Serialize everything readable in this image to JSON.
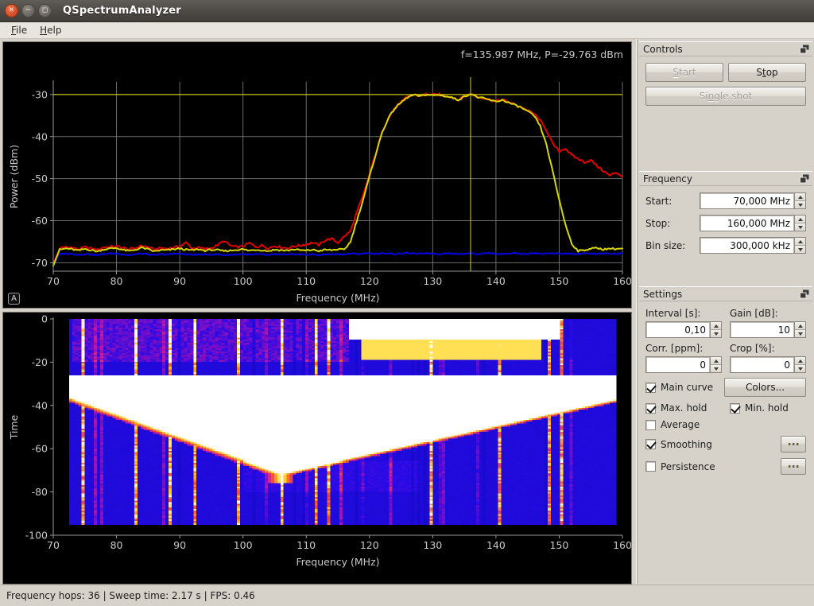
{
  "window": {
    "title": "QSpectrumAnalyzer",
    "close_icon": "close-icon",
    "minimize_icon": "minimize-icon",
    "maximize_icon": "maximize-icon"
  },
  "menubar": {
    "items": [
      {
        "label": "File",
        "mnemonic": "F"
      },
      {
        "label": "Help",
        "mnemonic": "H"
      }
    ]
  },
  "spectrum": {
    "cursor_readout": "f=135.987 MHz, P=-29.763 dBm",
    "autoscale_badge": "A",
    "xlabel": "Frequency (MHz)",
    "ylabel": "Power (dBm)"
  },
  "waterfall": {
    "xlabel": "Frequency (MHz)",
    "ylabel": "Time"
  },
  "controls": {
    "title": "Controls",
    "float_icon": "undock-icon",
    "start_label": "Start",
    "start_mnemonic": "S",
    "start_enabled": false,
    "stop_label": "Stop",
    "stop_mnemonic": "t",
    "stop_enabled": true,
    "single_shot_label": "Single shot",
    "single_shot_mnemonic": "n",
    "single_shot_enabled": false
  },
  "frequency": {
    "title": "Frequency",
    "float_icon": "undock-icon",
    "start_label": "Start:",
    "start_value": "70,000 MHz",
    "stop_label": "Stop:",
    "stop_value": "160,000 MHz",
    "bin_label": "Bin size:",
    "bin_value": "300,000 kHz"
  },
  "settings": {
    "title": "Settings",
    "float_icon": "undock-icon",
    "interval_label": "Interval [s]:",
    "interval_value": "0,10",
    "gain_label": "Gain [dB]:",
    "gain_value": "10",
    "corr_label": "Corr. [ppm]:",
    "corr_value": "0",
    "crop_label": "Crop [%]:",
    "crop_value": "0",
    "main_curve_label": "Main curve",
    "main_curve_checked": true,
    "colors_label": "Colors...",
    "max_hold_label": "Max. hold",
    "max_hold_checked": true,
    "min_hold_label": "Min. hold",
    "min_hold_checked": true,
    "average_label": "Average",
    "average_checked": false,
    "smoothing_label": "Smoothing",
    "smoothing_checked": true,
    "persistence_label": "Persistence",
    "persistence_checked": false,
    "smoothing_more_label": "...",
    "persistence_more_label": "..."
  },
  "statusbar": {
    "text": "Frequency hops: 36 | Sweep time: 2.17 s | FPS: 0.46"
  },
  "colors": {
    "main_curve": "#d8d800",
    "max_hold": "#e00000",
    "min_hold": "#0000e8",
    "cursor": "#d8d400",
    "grid": "#808080",
    "plot_bg": "#000000",
    "axis_text": "#c8c8c8",
    "accent": "#d4482a"
  },
  "chart_data": [
    {
      "type": "line",
      "id": "spectrum",
      "title": "",
      "xlabel": "Frequency (MHz)",
      "ylabel": "Power (dBm)",
      "xlim": [
        70,
        160
      ],
      "ylim": [
        -72,
        -27
      ],
      "xticks": [
        70,
        80,
        90,
        100,
        110,
        120,
        130,
        140,
        150,
        160
      ],
      "yticks": [
        -30,
        -40,
        -50,
        -60,
        -70
      ],
      "grid": true,
      "legend": "none",
      "annotations": [
        "f=135.987 MHz, P=-29.763 dBm"
      ],
      "cursor": {
        "x": 135.987,
        "y": -29.763
      },
      "x": [
        70,
        71,
        72,
        73,
        74,
        75,
        76,
        77,
        78,
        79,
        80,
        81,
        82,
        83,
        84,
        85,
        86,
        87,
        88,
        89,
        90,
        91,
        92,
        93,
        94,
        95,
        96,
        97,
        98,
        99,
        100,
        101,
        102,
        103,
        104,
        105,
        106,
        107,
        108,
        109,
        110,
        111,
        112,
        113,
        114,
        115,
        116,
        117,
        118,
        119,
        120,
        121,
        122,
        123,
        124,
        125,
        126,
        127,
        128,
        129,
        130,
        131,
        132,
        133,
        134,
        135,
        136,
        137,
        138,
        139,
        140,
        141,
        142,
        143,
        144,
        145,
        146,
        147,
        148,
        149,
        150,
        151,
        152,
        153,
        154,
        155,
        156,
        157,
        158,
        159,
        160
      ],
      "series": [
        {
          "name": "Max. hold",
          "color": "#e00000",
          "values": [
            -70.5,
            -66.6,
            -66.2,
            -66.4,
            -66.8,
            -66.3,
            -66.6,
            -66.9,
            -66.3,
            -66.2,
            -66.1,
            -66.4,
            -66.8,
            -66.5,
            -65.9,
            -66.3,
            -66.9,
            -66.5,
            -66.6,
            -66.4,
            -66.1,
            -65.2,
            -66.6,
            -66.4,
            -66.7,
            -66.5,
            -65.8,
            -64.8,
            -65.9,
            -66.3,
            -66.1,
            -65.3,
            -66.2,
            -65.9,
            -66.5,
            -66.0,
            -66.3,
            -66.5,
            -66.1,
            -65.9,
            -65.6,
            -65.2,
            -65.8,
            -64.6,
            -64.3,
            -65.2,
            -63.8,
            -62.5,
            -58.0,
            -54.0,
            -49.0,
            -44.0,
            -39.0,
            -35.5,
            -33.2,
            -31.8,
            -30.6,
            -30.0,
            -30.3,
            -29.9,
            -30.1,
            -30.0,
            -30.3,
            -30.6,
            -31.2,
            -30.4,
            -29.8,
            -30.5,
            -30.8,
            -31.2,
            -31.6,
            -31.2,
            -31.8,
            -32.4,
            -33.0,
            -33.8,
            -34.5,
            -36.2,
            -38.5,
            -41.8,
            -43.5,
            -42.8,
            -44.5,
            -45.3,
            -46.1,
            -45.6,
            -47.0,
            -48.2,
            -49.3,
            -48.5,
            -49.5
          ]
        },
        {
          "name": "Main curve",
          "color": "#d8d800",
          "values": [
            -70.5,
            -66.9,
            -66.6,
            -66.8,
            -67.1,
            -66.7,
            -67.0,
            -67.3,
            -66.8,
            -66.6,
            -66.5,
            -66.9,
            -67.2,
            -66.9,
            -66.4,
            -66.8,
            -67.3,
            -67.0,
            -67.0,
            -66.8,
            -66.6,
            -66.9,
            -67.0,
            -66.8,
            -67.1,
            -66.9,
            -67.0,
            -67.2,
            -67.1,
            -66.9,
            -66.8,
            -67.1,
            -66.9,
            -67.0,
            -67.2,
            -66.9,
            -67.0,
            -67.1,
            -66.8,
            -67.0,
            -67.1,
            -66.9,
            -67.2,
            -66.9,
            -67.0,
            -66.8,
            -66.9,
            -65.0,
            -60.0,
            -55.0,
            -49.5,
            -44.2,
            -39.0,
            -35.6,
            -33.3,
            -31.9,
            -30.7,
            -30.1,
            -30.4,
            -30.0,
            -30.2,
            -30.1,
            -30.4,
            -30.7,
            -31.3,
            -30.5,
            -29.8,
            -30.6,
            -30.9,
            -31.3,
            -31.7,
            -31.3,
            -31.9,
            -32.5,
            -33.1,
            -34.0,
            -35.0,
            -37.5,
            -42.0,
            -48.5,
            -55.0,
            -61.0,
            -65.5,
            -67.2,
            -67.0,
            -66.6,
            -66.5,
            -66.8,
            -66.6,
            -66.7,
            -66.6
          ]
        },
        {
          "name": "Min. hold",
          "color": "#0000e8",
          "values": [
            -70.5,
            -68.0,
            -67.8,
            -67.9,
            -68.1,
            -67.9,
            -68.0,
            -68.2,
            -67.9,
            -67.8,
            -67.8,
            -68.0,
            -68.2,
            -68.0,
            -67.8,
            -68.0,
            -68.2,
            -68.0,
            -68.0,
            -67.9,
            -67.8,
            -68.0,
            -68.1,
            -68.0,
            -68.1,
            -68.0,
            -68.0,
            -68.2,
            -68.1,
            -68.0,
            -67.9,
            -68.1,
            -68.0,
            -68.0,
            -68.2,
            -68.0,
            -68.0,
            -68.1,
            -67.9,
            -68.0,
            -68.1,
            -68.0,
            -68.2,
            -68.0,
            -68.0,
            -67.9,
            -68.0,
            -67.8,
            -67.9,
            -67.8,
            -67.7,
            -67.9,
            -67.8,
            -67.7,
            -67.9,
            -67.8,
            -67.7,
            -67.8,
            -67.9,
            -67.7,
            -67.8,
            -67.9,
            -67.7,
            -67.8,
            -67.9,
            -67.8,
            -67.7,
            -67.9,
            -67.8,
            -67.7,
            -67.8,
            -67.9,
            -67.8,
            -67.7,
            -67.9,
            -67.8,
            -67.7,
            -67.9,
            -67.8,
            -67.8,
            -67.9,
            -67.8,
            -67.8,
            -67.9,
            -67.8,
            -67.8,
            -67.9,
            -67.8,
            -67.8,
            -67.9,
            -67.8
          ]
        }
      ]
    },
    {
      "type": "heatmap",
      "id": "waterfall",
      "title": "",
      "xlabel": "Frequency (MHz)",
      "ylabel": "Time",
      "xlim": [
        70,
        160
      ],
      "ylim": [
        -100,
        0
      ],
      "xticks": [
        70,
        80,
        90,
        100,
        110,
        120,
        130,
        140,
        150,
        160
      ],
      "yticks": [
        0,
        -20,
        -40,
        -60,
        -80,
        -100
      ],
      "colormap": "blue-magenta-yellow-white",
      "description": "Waterfall spectrogram; blue noise floor with vertical carrier streaks, a saturated white band from ~117-150 MHz at the top rows, and a white diagonal sweep widening from ~105 MHz at time -70 to ~160 MHz at time -38"
    }
  ]
}
